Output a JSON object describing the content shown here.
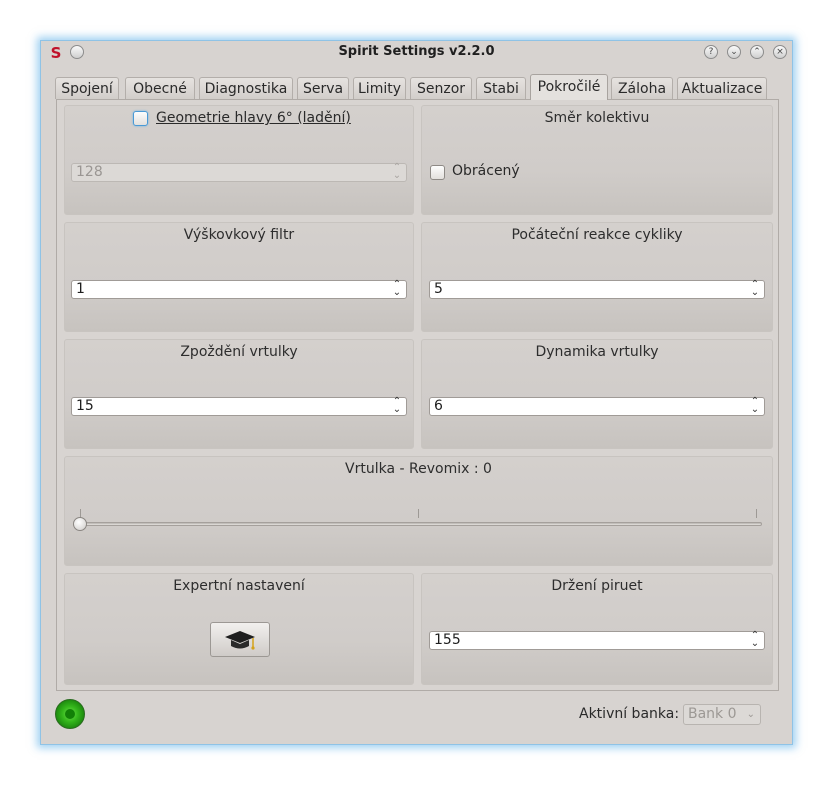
{
  "window": {
    "title": "Spirit Settings v2.2.0",
    "app_icon": "S"
  },
  "tabs": [
    {
      "label": "Spojení"
    },
    {
      "label": "Obecné"
    },
    {
      "label": "Diagnostika"
    },
    {
      "label": "Serva"
    },
    {
      "label": "Limity"
    },
    {
      "label": "Senzor"
    },
    {
      "label": "Stabi"
    },
    {
      "label": "Pokročilé"
    },
    {
      "label": "Záloha"
    },
    {
      "label": "Aktualizace"
    }
  ],
  "active_tab": "Pokročilé",
  "groups": {
    "head_geometry": {
      "checkbox_label": "Geometrie hlavy 6° (ladění)",
      "checked": false,
      "value": "128",
      "disabled": true
    },
    "collective": {
      "title": "Směr kolektivu",
      "checkbox_label": "Obrácený",
      "checked": false
    },
    "height_filter": {
      "title": "Výškovkový filtr",
      "value": "1"
    },
    "cyclic_reaction": {
      "title": "Počáteční reakce cykliky",
      "value": "5"
    },
    "rudder_delay": {
      "title": "Zpoždění vrtulky",
      "value": "15"
    },
    "rudder_dynamics": {
      "title": "Dynamika vrtulky",
      "value": "6"
    },
    "revomix": {
      "title": "Vrtulka - Revomix : 0",
      "slider_value": 0
    },
    "expert": {
      "title": "Expertní nastavení",
      "button_icon": "graduation-cap-icon"
    },
    "pirouette": {
      "title": "Držení piruet",
      "value": "155"
    }
  },
  "footer": {
    "bank_label": "Aktivní banka:",
    "bank_value": "Bank 0",
    "status": "connected"
  },
  "colors": {
    "status_led": "#33b51b",
    "focus_accent": "#4a9ad6",
    "app_icon": "#c0102a"
  }
}
